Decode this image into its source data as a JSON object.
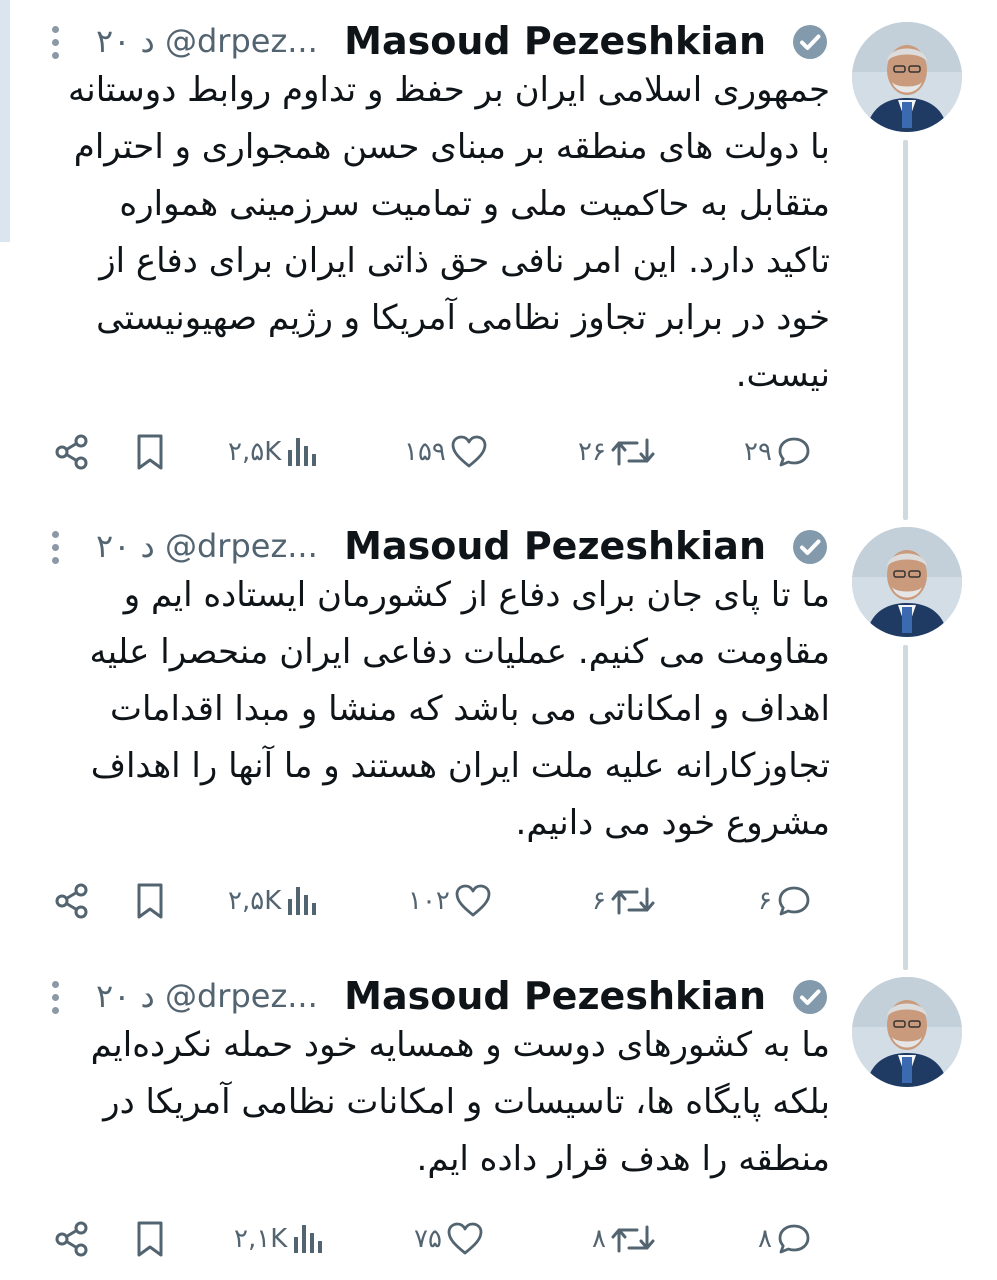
{
  "author": {
    "name": "Masoud Pezeshkian",
    "handle": "@drpez...",
    "time": "۲۰ د"
  },
  "colors": {
    "icon_gray": "#536471",
    "verified_gray": "#829aab",
    "thread_line": "#cfd9de",
    "text": "#0f1419"
  },
  "icons": {
    "reply": "reply-icon",
    "retweet": "retweet-icon",
    "like": "like-icon",
    "views": "views-icon",
    "bookmark": "bookmark-icon",
    "share": "share-icon",
    "verified": "verified-badge-icon",
    "more": "more-options-icon"
  },
  "tweets": [
    {
      "text": "جمهوری اسلامی ایران بر حفظ و تداوم روابط دوستانه با دولت های منطقه بر مبنای حسن همجواری و احترام متقابل به حاکمیت ملی و تمامیت سرزمینی همواره تاکید دارد. این امر نافی حق ذاتی ایران برای دفاع از خود در برابر تجاوز نظامی آمریکا و رژیم صهیونیستی نیست.",
      "replies": "۲۹",
      "retweets": "۲۶",
      "likes": "۱۵۹",
      "views": "۲,۵K"
    },
    {
      "text": "ما تا پای جان برای دفاع از کشورمان ایستاده ایم و مقاومت می کنیم. عملیات دفاعی ایران منحصرا علیه اهداف و امکاناتی می باشد که منشا و مبدا اقدامات تجاوزکارانه علیه ملت ایران هستند و ما آنها را اهداف مشروع خود می دانیم.",
      "replies": "۶",
      "retweets": "۶",
      "likes": "۱۰۲",
      "views": "۲,۵K"
    },
    {
      "text": "ما به کشورهای دوست و همسایه خود حمله نکرده‌ایم بلکه پایگاه ها، تاسیسات و امکانات نظامی آمریکا در منطقه را هدف قرار داده ایم.",
      "replies": "۸",
      "retweets": "۸",
      "likes": "۷۵",
      "views": "۲,۱K"
    }
  ]
}
